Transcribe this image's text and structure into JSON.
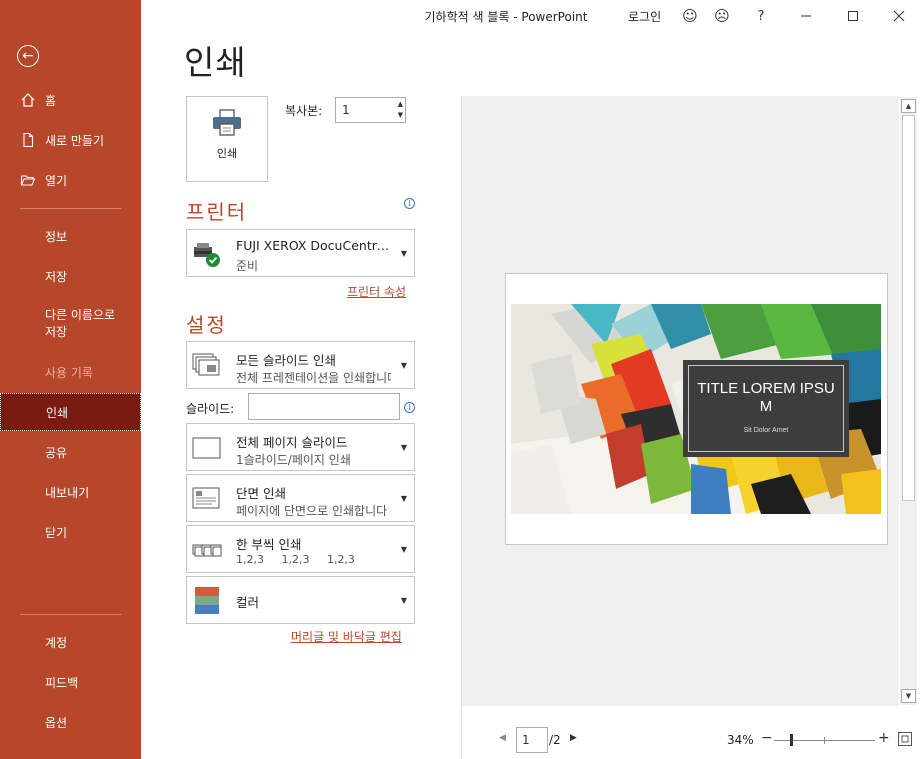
{
  "window": {
    "title": "기하학적 색 블록  -  PowerPoint",
    "login": "로그인",
    "help": "?"
  },
  "sidebar": {
    "items": [
      {
        "label": "홈"
      },
      {
        "label": "새로 만들기"
      },
      {
        "label": "열기"
      },
      {
        "label": "정보"
      },
      {
        "label": "저장"
      },
      {
        "label": "다른 이름으로 저장"
      },
      {
        "label": "사용 기록"
      },
      {
        "label": "인쇄"
      },
      {
        "label": "공유"
      },
      {
        "label": "내보내기"
      },
      {
        "label": "닫기"
      },
      {
        "label": "계정"
      },
      {
        "label": "피드백"
      },
      {
        "label": "옵션"
      }
    ]
  },
  "main": {
    "heading": "인쇄",
    "print_button": "인쇄",
    "copies_label": "복사본:",
    "copies_value": "1",
    "printer_heading": "프린터",
    "printer": {
      "name": "FUJI XEROX DocuCentre-IV",
      "status": "준비"
    },
    "printer_properties_link": "프린터 속성",
    "settings_heading": "설정",
    "settings": [
      {
        "line1": "모든 슬라이드 인쇄",
        "line2": "전체 프레젠테이션을 인쇄합니다"
      },
      {
        "line1": "전체 페이지 슬라이드",
        "line2": "1슬라이드/페이지 인쇄"
      },
      {
        "line1": "단면 인쇄",
        "line2": "페이지에 단면으로 인쇄합니다"
      },
      {
        "line1": "한 부씩 인쇄",
        "line2": "1,2,3     1,2,3     1,2,3"
      },
      {
        "line1": "컬러",
        "line2": ""
      }
    ],
    "slides_label": "슬라이드:",
    "slides_value": "",
    "header_footer_link": "머리글 및 바닥글 편집"
  },
  "preview": {
    "slide_title": "TITLE LOREM IPSUM",
    "slide_subtitle": "Sit Dolor Amet",
    "current_page": "1",
    "total_pages": "/2",
    "zoom": "34%"
  },
  "colors": {
    "accent": "#b7472a",
    "selected_bg": "#7a1b12"
  }
}
